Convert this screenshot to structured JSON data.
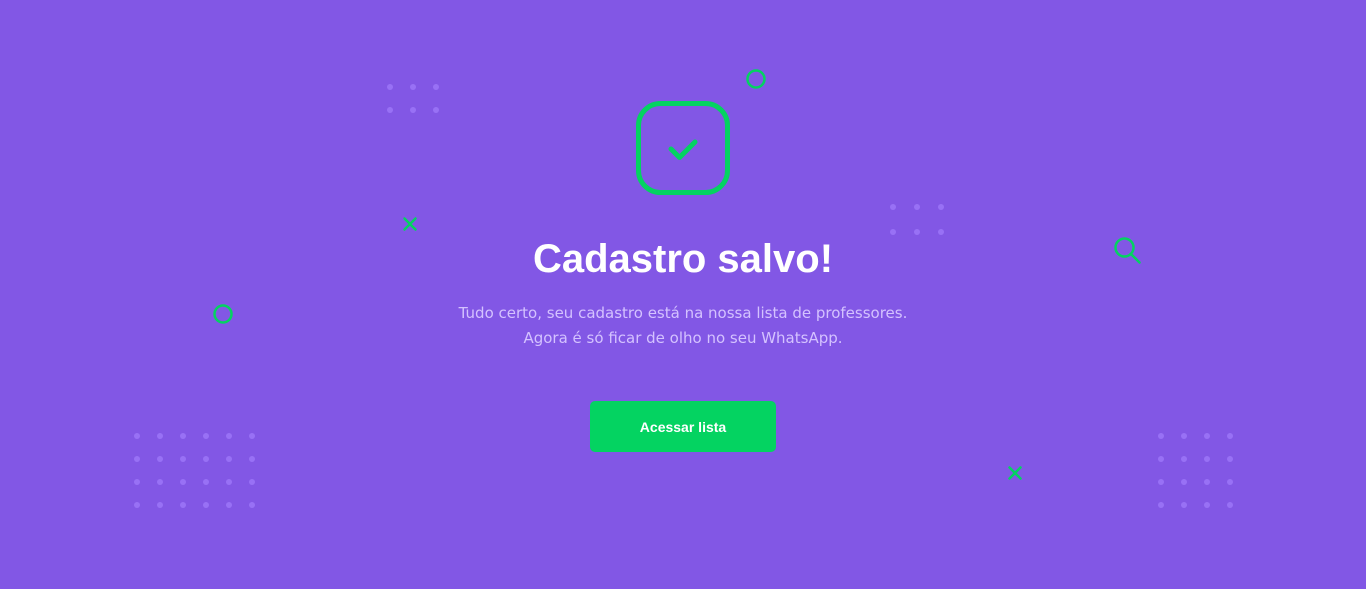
{
  "success": {
    "title": "Cadastro salvo!",
    "description_line1": "Tudo certo, seu cadastro está na nossa lista de professores.",
    "description_line2": "Agora é só ficar de olho no seu WhatsApp.",
    "button_label": "Acessar lista",
    "icon": "check-icon"
  },
  "colors": {
    "background": "#8257e5",
    "accent": "#04d361",
    "title": "#ffffff",
    "description": "#d4c2ff",
    "decor_dots": "#9871f5"
  },
  "decorations": {
    "icons": [
      "circle-icon",
      "close-icon",
      "search-icon",
      "dot-grid"
    ]
  }
}
